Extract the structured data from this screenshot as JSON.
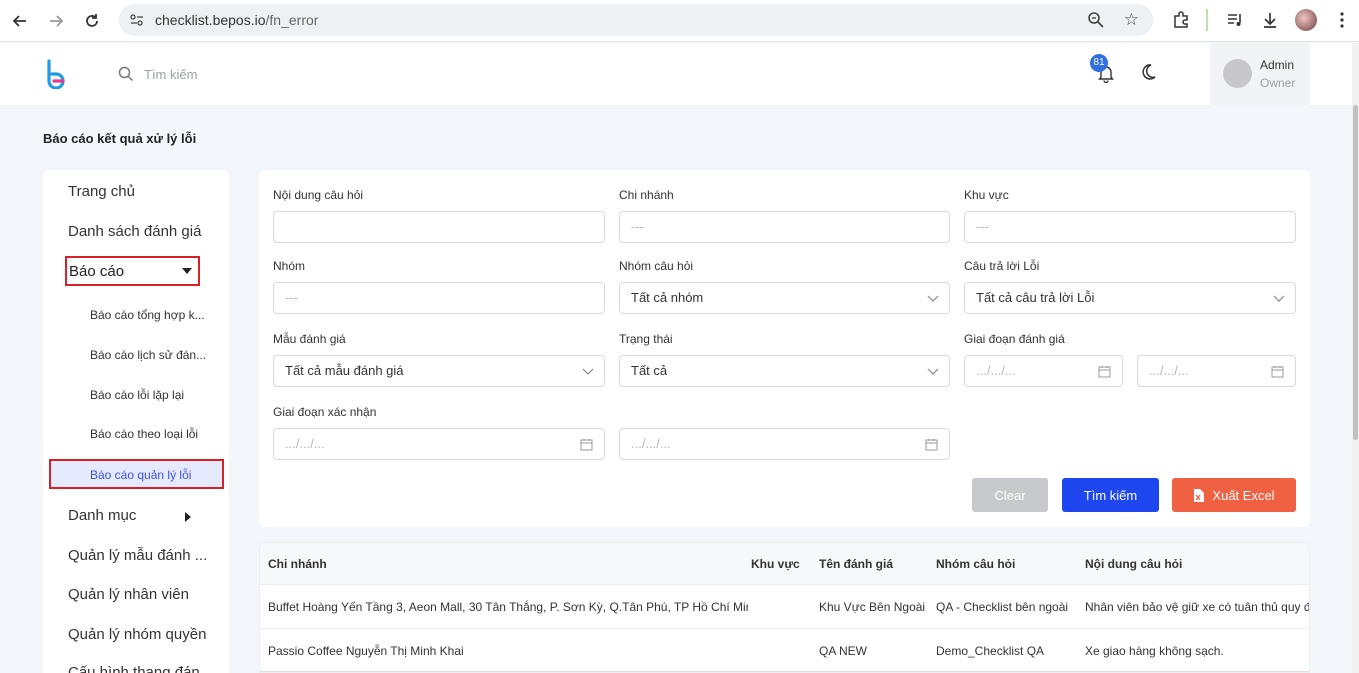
{
  "browser": {
    "url_host": "checklist.bepos.io",
    "url_path": "/fn_error"
  },
  "header": {
    "search_placeholder": "Tìm kiếm",
    "notification_count": "81",
    "user_name": "Admin",
    "user_role": "Owner"
  },
  "page": {
    "title": "Báo cáo kết quả xử lý lỗi"
  },
  "sidebar": {
    "items": [
      {
        "label": "Trang chủ"
      },
      {
        "label": "Danh sách đánh giá"
      },
      {
        "label": "Báo cáo"
      },
      {
        "label": "Danh mục"
      },
      {
        "label": "Quản lý mẫu đánh ..."
      },
      {
        "label": "Quản lý nhân viên"
      },
      {
        "label": "Quản lý nhóm quyền"
      },
      {
        "label": "Cấu hình thang đán..."
      }
    ],
    "report_subitems": [
      {
        "label": "Báo cáo tổng hợp k..."
      },
      {
        "label": "Báo cáo lịch sử đán..."
      },
      {
        "label": "Báo cáo lỗi lặp lại"
      },
      {
        "label": "Báo cáo theo loại lỗi"
      },
      {
        "label": "Báo cáo quản lý lỗi"
      }
    ]
  },
  "filters": {
    "question_content": {
      "label": "Nội dung câu hỏi",
      "value": ""
    },
    "branch": {
      "label": "Chi nhánh",
      "placeholder": "---"
    },
    "area": {
      "label": "Khu vực",
      "placeholder": "---"
    },
    "group": {
      "label": "Nhóm",
      "placeholder": "---"
    },
    "question_group": {
      "label": "Nhóm câu hỏi",
      "value": "Tất cả nhóm"
    },
    "error_answer": {
      "label": "Câu trả lời Lỗi",
      "value": "Tất cả câu trả lời Lỗi"
    },
    "template": {
      "label": "Mẫu đánh giá",
      "value": "Tất cả mẫu đánh giá"
    },
    "status": {
      "label": "Trạng thái",
      "value": "Tất cả"
    },
    "eval_period": {
      "label": "Giai đoạn đánh giá",
      "from_placeholder": ".../.../...",
      "to_placeholder": ".../.../..."
    },
    "confirm_period": {
      "label": "Giai đoạn xác nhận",
      "from_placeholder": ".../.../...",
      "to_placeholder": ".../.../..."
    }
  },
  "buttons": {
    "clear": "Clear",
    "search": "Tìm kiếm",
    "excel": "Xuất Excel"
  },
  "table": {
    "headers": [
      "Chi nhánh",
      "Khu vực",
      "Tên đánh giá",
      "Nhóm câu hỏi",
      "Nội dung câu hỏi"
    ],
    "rows": [
      [
        "Buffet Hoàng Yến Tầng 3, Aeon Mall, 30 Tân Thắng, P. Sơn Kỳ, Q.Tân Phú, TP Hồ Chí Minh",
        "",
        "Khu Vực Bên Ngoài",
        "QA - Checklist bên ngoài",
        "Nhân viên bảo vệ giữ xe có tuân thủ quy đ"
      ],
      [
        "Passio Coffee Nguyễn Thị Minh Khai",
        "",
        "QA NEW",
        "Demo_Checklist QA",
        "Xe giao hàng không sạch."
      ]
    ]
  },
  "colors": {
    "primary": "#1f47ef",
    "excel": "#f06043",
    "highlight_border": "#d92027",
    "badge": "#2f6fdf"
  }
}
